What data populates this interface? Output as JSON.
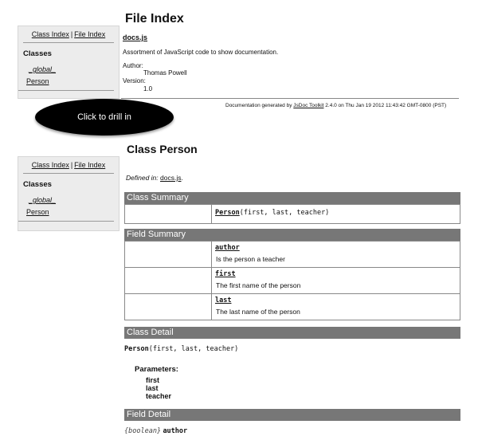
{
  "sidebar": {
    "class_index": "Class Index",
    "separator": "|",
    "file_index": "File Index",
    "heading": "Classes",
    "items": [
      "_global_",
      "Person"
    ]
  },
  "file_index": {
    "title": "File Index",
    "file_name": "docs.js",
    "description": "Assortment of JavaScript code to show documentation.",
    "author_label": "Author:",
    "author": "Thomas Powell",
    "version_label": "Version:",
    "version": "1.0",
    "footer": {
      "prefix": "Documentation generated by",
      "tool": "JsDoc Toolkit",
      "suffix": "2.4.0 on Thu Jan 19 2012 11:43:42 GMT-0800 (PST)"
    }
  },
  "callout": "Click to drill in",
  "class_page": {
    "title": "Class Person",
    "defined_in_label": "Defined in:",
    "defined_in_file": "docs.js",
    "defined_in_end": ".",
    "class_summary_label": "Class Summary",
    "constructor": {
      "name": "Person",
      "args": "(first, last, teacher)"
    },
    "field_summary_label": "Field Summary",
    "fields": [
      {
        "name": "author",
        "desc": "Is the person a teacher"
      },
      {
        "name": "first",
        "desc": "The first name of the person"
      },
      {
        "name": "last",
        "desc": "The last name of the person"
      }
    ],
    "class_detail_label": "Class Detail",
    "detail_signature": {
      "name": "Person",
      "args": "(first, last, teacher)"
    },
    "parameters_label": "Parameters:",
    "parameters": [
      "first",
      "last",
      "teacher"
    ],
    "field_detail_label": "Field Detail",
    "field_detail": {
      "type": "{boolean}",
      "name": "author"
    }
  }
}
